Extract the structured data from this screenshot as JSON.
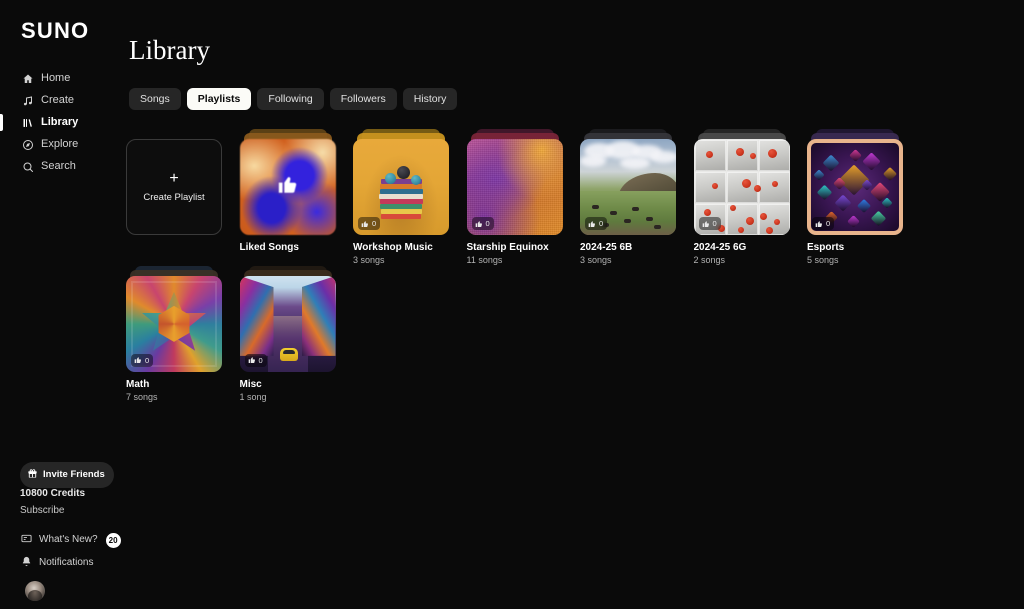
{
  "brand": "SUNO",
  "sidebar": {
    "nav": [
      {
        "label": "Home",
        "icon": "home-icon",
        "active": false
      },
      {
        "label": "Create",
        "icon": "music-note-icon",
        "active": false
      },
      {
        "label": "Library",
        "icon": "library-icon",
        "active": true
      },
      {
        "label": "Explore",
        "icon": "compass-icon",
        "active": false
      },
      {
        "label": "Search",
        "icon": "search-icon",
        "active": false
      }
    ],
    "invite_label": "Invite Friends",
    "invite_icon": "gift-icon",
    "credits": "10800 Credits",
    "subscribe": "Subscribe",
    "whats_new_label": "What's New?",
    "whats_new_icon": "megaphone-icon",
    "whats_new_badge": "20",
    "notifications_label": "Notifications",
    "notifications_icon": "bell-icon",
    "avatar_name": "user-avatar"
  },
  "header": {
    "title": "Library"
  },
  "tabs": [
    {
      "label": "Songs",
      "active": false
    },
    {
      "label": "Playlists",
      "active": true
    },
    {
      "label": "Following",
      "active": false
    },
    {
      "label": "Followers",
      "active": false
    },
    {
      "label": "History",
      "active": false
    }
  ],
  "create_card": {
    "label": "Create Playlist",
    "plus": "+"
  },
  "playlists": [
    {
      "title": "Liked Songs",
      "subtitle": "",
      "likes": null,
      "art": "art-liked",
      "show_center_thumb": true
    },
    {
      "title": "Workshop Music",
      "subtitle": "3 songs",
      "likes": "0",
      "art": "art-workshop",
      "show_center_thumb": false
    },
    {
      "title": "Starship Equinox",
      "subtitle": "11 songs",
      "likes": "0",
      "art": "art-starship",
      "show_center_thumb": false
    },
    {
      "title": "2024-25 6B",
      "subtitle": "3 songs",
      "likes": "0",
      "art": "art-6b",
      "show_center_thumb": false
    },
    {
      "title": "2024-25 6G",
      "subtitle": "2 songs",
      "likes": "0",
      "art": "art-6g",
      "show_center_thumb": false
    },
    {
      "title": "Esports",
      "subtitle": "5 songs",
      "likes": "0",
      "art": "art-esports",
      "show_center_thumb": false
    },
    {
      "title": "Math",
      "subtitle": "7 songs",
      "likes": "0",
      "art": "art-math",
      "show_center_thumb": false
    },
    {
      "title": "Misc",
      "subtitle": "1 song",
      "likes": "0",
      "art": "art-misc",
      "show_center_thumb": false
    }
  ],
  "colors": {
    "background": "#0a0a0a",
    "tab_inactive_bg": "#262626",
    "tab_active_bg": "#fbfbf7",
    "accent_text": "#ffffff",
    "muted_text": "#b4b4b4"
  }
}
